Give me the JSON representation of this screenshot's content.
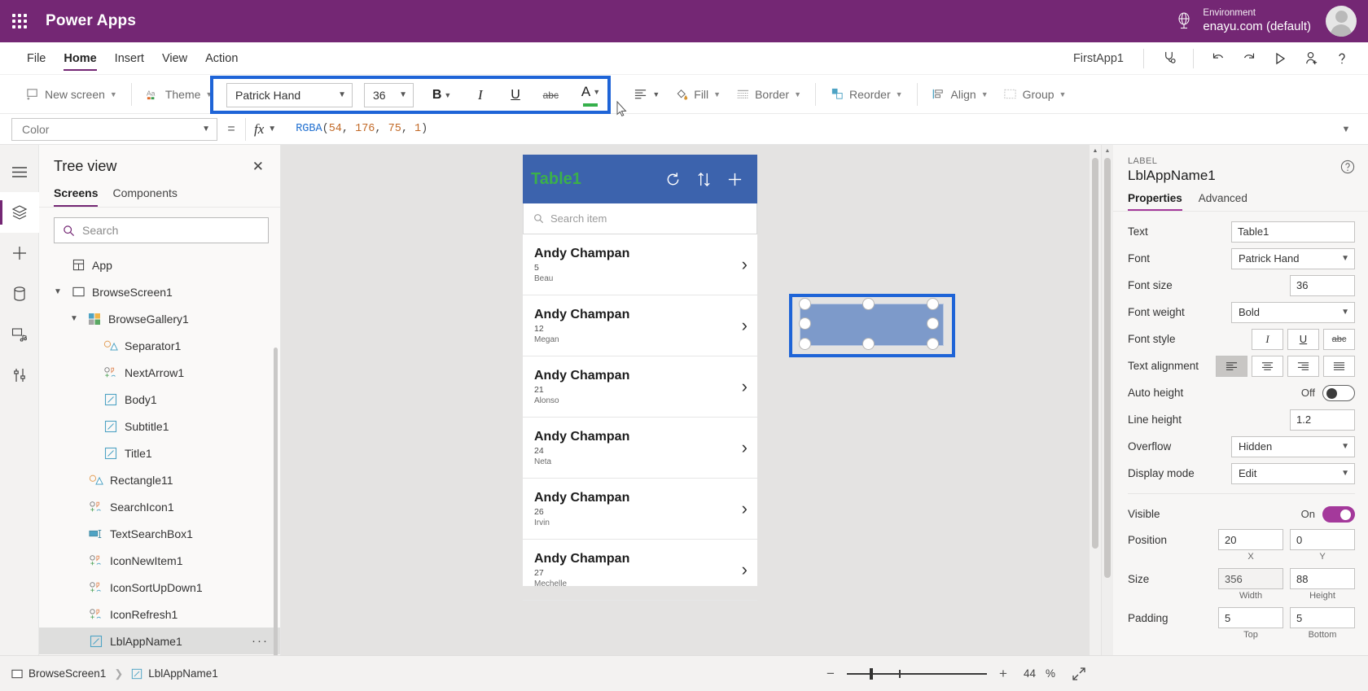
{
  "topbar": {
    "brand": "Power Apps",
    "waffle_icon": "app-launcher-icon",
    "globe_icon": "environment-globe-icon",
    "environment_label": "Environment",
    "environment_value": "enayu.com (default)",
    "avatar_icon": "user-avatar"
  },
  "menubar": {
    "items": [
      {
        "label": "File",
        "active": false
      },
      {
        "label": "Home",
        "active": true
      },
      {
        "label": "Insert",
        "active": false
      },
      {
        "label": "View",
        "active": false
      },
      {
        "label": "Action",
        "active": false
      }
    ],
    "app_name": "FirstApp1",
    "icons": [
      {
        "name": "app-checker-icon"
      },
      {
        "name": "undo-icon"
      },
      {
        "name": "redo-icon"
      },
      {
        "name": "preview-play-icon"
      },
      {
        "name": "share-user-icon"
      },
      {
        "name": "help-question-icon"
      }
    ]
  },
  "ribbon": {
    "new_screen": "New screen",
    "theme": "Theme",
    "font_name": "Patrick Hand",
    "font_size": "36",
    "bold": "B",
    "italic": "I",
    "underline": "U",
    "strikethrough": "abc",
    "font_color": "A",
    "font_color_swatch": "#36b04b",
    "align": "align-text-icon",
    "fill": "Fill",
    "border": "Border",
    "reorder": "Reorder",
    "align_group": "Align",
    "group": "Group",
    "highlight_color": "#1e64d7"
  },
  "formulabar": {
    "property": "Color",
    "equals": "=",
    "fx": "fx",
    "formula_fn": "RGBA",
    "formula_args": [
      "54",
      "176",
      "75",
      "1"
    ],
    "formula_full": "RGBA(54, 176, 75, 1)"
  },
  "rail": {
    "items": [
      {
        "name": "hamburger-menu-icon",
        "active": false
      },
      {
        "name": "tree-view-layers-icon",
        "active": true
      },
      {
        "name": "insert-plus-icon",
        "active": false
      },
      {
        "name": "data-sources-icon",
        "active": false
      },
      {
        "name": "media-icon",
        "active": false
      },
      {
        "name": "advanced-tools-icon",
        "active": false
      }
    ]
  },
  "treeview": {
    "title": "Tree view",
    "close_icon": "close-icon",
    "tabs": [
      {
        "label": "Screens",
        "active": true
      },
      {
        "label": "Components",
        "active": false
      }
    ],
    "search_placeholder": "Search",
    "search_value": "",
    "search_icon": "search-icon",
    "items": [
      {
        "label": "App",
        "indent": 0,
        "twisty": "",
        "icon": "app-icon",
        "selected": false
      },
      {
        "label": "BrowseScreen1",
        "indent": 0,
        "twisty": "v",
        "icon": "screen-icon",
        "selected": false
      },
      {
        "label": "BrowseGallery1",
        "indent": 1,
        "twisty": "v",
        "icon": "gallery-icon",
        "selected": false
      },
      {
        "label": "Separator1",
        "indent": 2,
        "twisty": "",
        "icon": "shape-icon",
        "selected": false
      },
      {
        "label": "NextArrow1",
        "indent": 2,
        "twisty": "",
        "icon": "icon-control-icon",
        "selected": false
      },
      {
        "label": "Body1",
        "indent": 2,
        "twisty": "",
        "icon": "label-icon",
        "selected": false
      },
      {
        "label": "Subtitle1",
        "indent": 2,
        "twisty": "",
        "icon": "label-icon",
        "selected": false
      },
      {
        "label": "Title1",
        "indent": 2,
        "twisty": "",
        "icon": "label-icon",
        "selected": false
      },
      {
        "label": "Rectangle11",
        "indent": 1,
        "twisty": "",
        "icon": "shape-icon",
        "selected": false
      },
      {
        "label": "SearchIcon1",
        "indent": 1,
        "twisty": "",
        "icon": "icon-control-icon",
        "selected": false
      },
      {
        "label": "TextSearchBox1",
        "indent": 1,
        "twisty": "",
        "icon": "textinput-icon",
        "selected": false
      },
      {
        "label": "IconNewItem1",
        "indent": 1,
        "twisty": "",
        "icon": "icon-control-icon",
        "selected": false
      },
      {
        "label": "IconSortUpDown1",
        "indent": 1,
        "twisty": "",
        "icon": "icon-control-icon",
        "selected": false
      },
      {
        "label": "IconRefresh1",
        "indent": 1,
        "twisty": "",
        "icon": "icon-control-icon",
        "selected": false
      },
      {
        "label": "LblAppName1",
        "indent": 1,
        "twisty": "",
        "icon": "label-icon",
        "selected": true,
        "overflow": "···"
      }
    ]
  },
  "canvas": {
    "app_title": "Table1",
    "app_title_color": "#3bb04b",
    "header_bg": "#3c63ad",
    "header_icons": [
      "refresh-icon",
      "sort-updown-icon",
      "add-plus-icon"
    ],
    "search_placeholder": "Search item",
    "search_icon": "search-icon",
    "gallery": [
      {
        "title": "Andy Champan",
        "subtitle": "5",
        "body": "Beau",
        "chevron": "›"
      },
      {
        "title": "Andy Champan",
        "subtitle": "12",
        "body": "Megan",
        "chevron": "›"
      },
      {
        "title": "Andy Champan",
        "subtitle": "21",
        "body": "Alonso",
        "chevron": "›"
      },
      {
        "title": "Andy Champan",
        "subtitle": "24",
        "body": "Neta",
        "chevron": "›"
      },
      {
        "title": "Andy Champan",
        "subtitle": "26",
        "body": "Irvin",
        "chevron": "›"
      },
      {
        "title": "Andy Champan",
        "subtitle": "27",
        "body": "Mechelle",
        "chevron": "›"
      }
    ],
    "selection_color": "#1e64d7"
  },
  "statusbar": {
    "breadcrumbs": [
      {
        "label": "BrowseScreen1",
        "icon": "screen-icon"
      },
      {
        "label": "LblAppName1",
        "icon": "label-icon"
      }
    ],
    "zoom_out": "−",
    "zoom_in": "+",
    "zoom_value": "44",
    "zoom_unit": "%",
    "fit_icon": "fit-to-screen-icon"
  },
  "properties": {
    "kind": "LABEL",
    "name": "LblAppName1",
    "help_icon": "help-circle-icon",
    "tabs": [
      {
        "label": "Properties",
        "active": true
      },
      {
        "label": "Advanced",
        "active": false
      }
    ],
    "text_label": "Text",
    "text_value": "Table1",
    "font_label": "Font",
    "font_value": "Patrick Hand",
    "font_size_label": "Font size",
    "font_size_value": "36",
    "font_weight_label": "Font weight",
    "font_weight_value": "Bold",
    "font_style_label": "Font style",
    "font_style_options": [
      {
        "glyph": "I",
        "name": "italic-button",
        "on": false
      },
      {
        "glyph": "U",
        "name": "underline-button",
        "on": false
      },
      {
        "glyph": "abc",
        "name": "strikethrough-button",
        "on": false
      }
    ],
    "text_alignment_label": "Text alignment",
    "text_alignment_options": [
      {
        "name": "align-left-button",
        "on": true
      },
      {
        "name": "align-center-button",
        "on": false
      },
      {
        "name": "align-right-button",
        "on": false
      },
      {
        "name": "align-justify-button",
        "on": false
      }
    ],
    "auto_height_label": "Auto height",
    "auto_height_state": "Off",
    "auto_height_on": false,
    "line_height_label": "Line height",
    "line_height_value": "1.2",
    "overflow_label": "Overflow",
    "overflow_value": "Hidden",
    "display_mode_label": "Display mode",
    "display_mode_value": "Edit",
    "visible_label": "Visible",
    "visible_state": "On",
    "visible_on": true,
    "position_label": "Position",
    "position_x": "20",
    "position_y": "0",
    "position_x_cap": "X",
    "position_y_cap": "Y",
    "size_label": "Size",
    "size_width": "356",
    "size_height": "88",
    "size_width_cap": "Width",
    "size_height_cap": "Height",
    "padding_label": "Padding",
    "padding_top": "5",
    "padding_bottom": "5",
    "padding_top_cap": "Top",
    "padding_bottom_cap": "Bottom",
    "accent": "#a4399b"
  }
}
